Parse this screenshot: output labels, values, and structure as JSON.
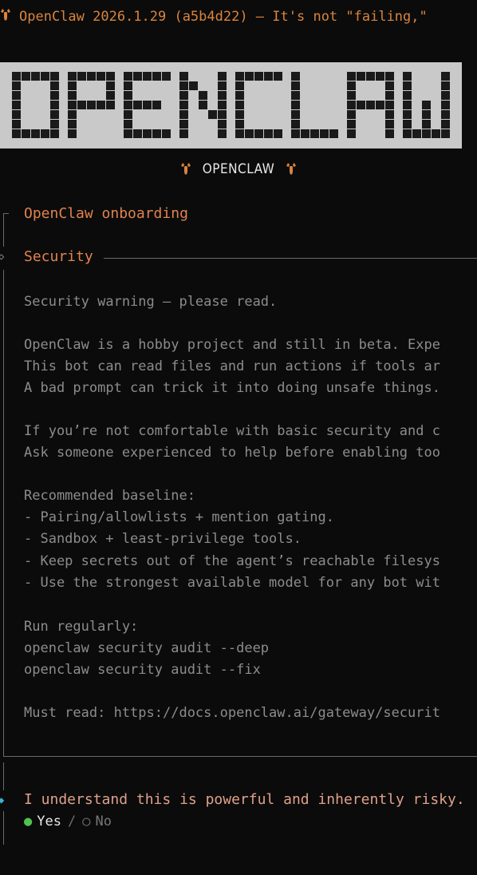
{
  "header": {
    "lobster_icon": "lobster-icon",
    "title": "OpenClaw 2026.1.29 (a5b4d22) — It's not \"failing,\""
  },
  "banner": {
    "text": "OPENCLAW",
    "background_color": "#c9c9c9",
    "pixel_color": "#1a1a1a"
  },
  "sub_banner": {
    "label": "OPENCLAW",
    "icon": "lobster-icon"
  },
  "onboarding": {
    "title": "OpenClaw onboarding"
  },
  "security": {
    "title": "Security",
    "warning": "Security warning — please read.",
    "para1": [
      "OpenClaw is a hobby project and still in beta. Expe",
      "This bot can read files and run actions if tools ar",
      "A bad prompt can trick it into doing unsafe things."
    ],
    "para2": [
      "If you’re not comfortable with basic security and c",
      "Ask someone experienced to help before enabling too"
    ],
    "baseline_heading": "Recommended baseline:",
    "baseline_items": [
      "- Pairing/allowlists + mention gating.",
      "- Sandbox + least-privilege tools.",
      "- Keep secrets out of the agent’s reachable filesys",
      "- Use the strongest available model for any bot wit"
    ],
    "run_heading": "Run regularly:",
    "commands": [
      "openclaw security audit --deep",
      "openclaw security audit --fix"
    ],
    "must_read": "Must read: https://docs.openclaw.ai/gateway/securit"
  },
  "prompt": {
    "question": "I understand this is powerful and inherently risky.",
    "options": [
      {
        "label": "Yes",
        "selected": true
      },
      {
        "label": "No",
        "selected": false
      }
    ],
    "separator": "/",
    "selected_dot": "●",
    "unselected_dot": "○"
  },
  "colors": {
    "accent_orange": "#e0834e",
    "body_gray": "#8c8c8c",
    "active_cyan": "#39b3d6",
    "selected_green": "#4fc24f"
  }
}
